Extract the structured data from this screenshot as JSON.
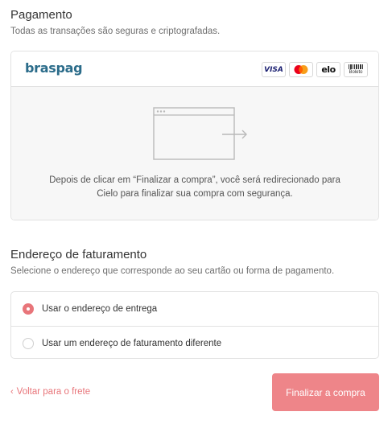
{
  "payment": {
    "title": "Pagamento",
    "subtitle": "Todas as transações são seguras e criptografadas.",
    "gateway": {
      "logo_text": "braspag",
      "cards": {
        "visa": "VISA",
        "elo": "elo",
        "boleto": "Boleto"
      },
      "redirect_text": "Depois de clicar em “Finalizar a compra”, você será redirecionado para Cielo para finalizar sua compra com segurança."
    }
  },
  "billing": {
    "title": "Endereço de faturamento",
    "subtitle": "Selecione o endereço que corresponde ao seu cartão ou forma de pagamento.",
    "options": [
      {
        "label": "Usar o endereço de entrega",
        "selected": true
      },
      {
        "label": "Usar um endereço de faturamento diferente",
        "selected": false
      }
    ]
  },
  "footer": {
    "back_label": "Voltar para o frete",
    "finish_label": "Finalizar a compra"
  },
  "colors": {
    "accent": "#ee8589",
    "brand_logo": "#2b6c8a"
  },
  "icons": {
    "back": "chevron-left-icon",
    "redirect": "browser-redirect-icon"
  }
}
